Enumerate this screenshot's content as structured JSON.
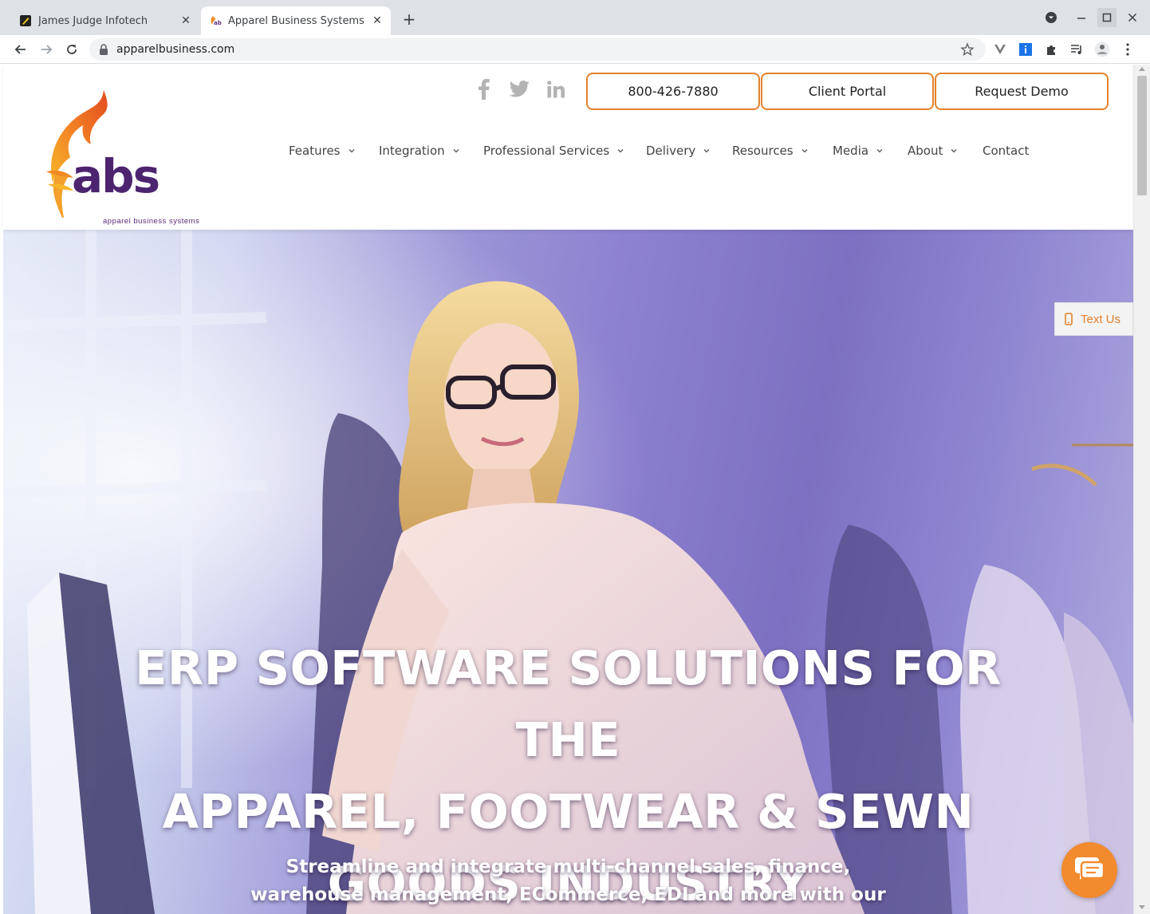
{
  "browser": {
    "tabs": [
      {
        "title": "James Judge Infotech",
        "active": false,
        "favicon": "pencil-note-icon"
      },
      {
        "title": "Apparel Business Systems",
        "active": true,
        "favicon": "abs-logo-icon"
      }
    ],
    "url": "apparelbusiness.com"
  },
  "header": {
    "logo": {
      "text": "abs",
      "subtitle": "apparel business systems"
    },
    "social": [
      "facebook-icon",
      "twitter-icon",
      "linkedin-icon"
    ],
    "cta": {
      "phone": "800-426-7880",
      "client_portal": "Client Portal",
      "request_demo": "Request Demo"
    },
    "nav": [
      {
        "label": "Features",
        "has_dropdown": true
      },
      {
        "label": "Integration",
        "has_dropdown": true
      },
      {
        "label": "Professional Services",
        "has_dropdown": true
      },
      {
        "label": "Delivery",
        "has_dropdown": true
      },
      {
        "label": "Resources",
        "has_dropdown": true
      },
      {
        "label": "Media",
        "has_dropdown": true
      },
      {
        "label": "About",
        "has_dropdown": true
      },
      {
        "label": "Contact",
        "has_dropdown": false
      }
    ]
  },
  "hero": {
    "title_lines": [
      "ERP SOFTWARE SOLUTIONS FOR THE",
      "APPAREL, FOOTWEAR & SEWN",
      "GOODS INDUSTRY"
    ],
    "subtitle_lines": [
      "Streamline and integrate multi-channel sales, finance,",
      "warehouse management, ECommerce, EDI and more with our"
    ]
  },
  "widgets": {
    "text_us": "Text Us",
    "chat_icon": "chat-bubble-icon"
  },
  "colors": {
    "accent": "#e4812c",
    "brand_purple": "#5b2a7a",
    "tab_strip": "#dee1e6"
  }
}
